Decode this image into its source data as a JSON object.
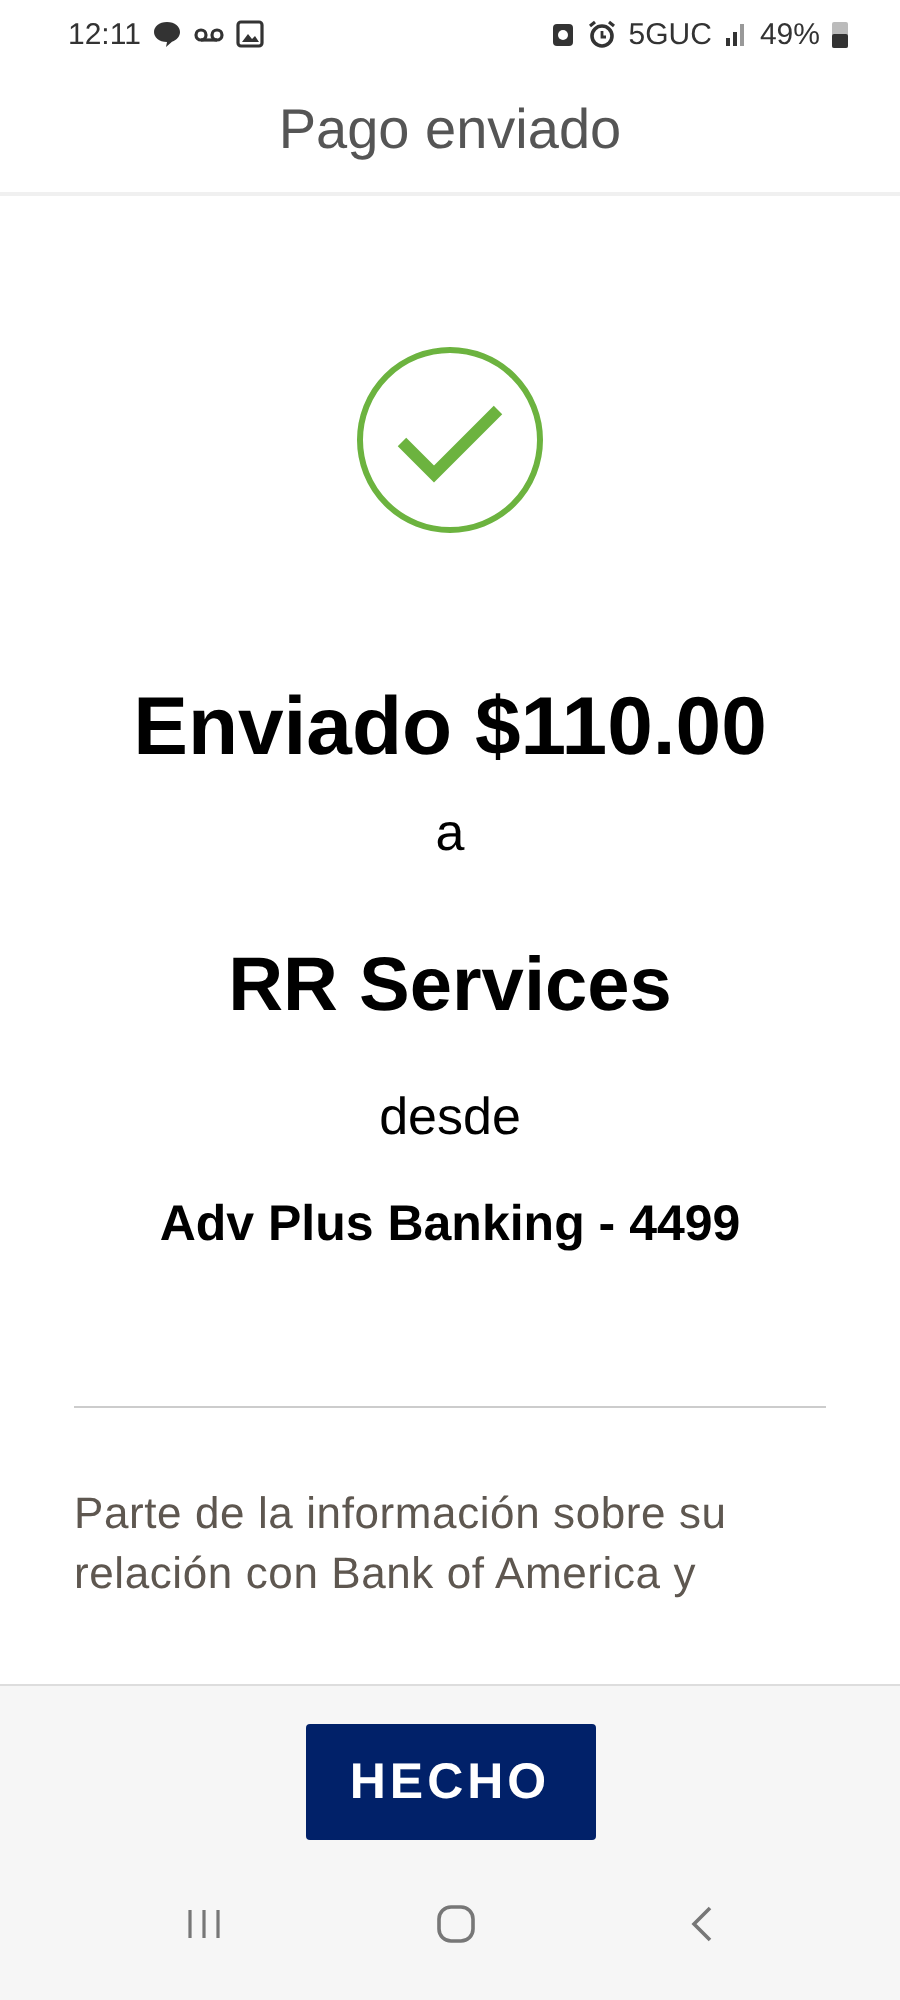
{
  "status_bar": {
    "time": "12:11",
    "network": "5GUC",
    "battery": "49%"
  },
  "header": {
    "title": "Pago enviado"
  },
  "confirmation": {
    "sent_line": "Enviado $110.00",
    "to_word": "a",
    "recipient": "RR Services",
    "from_word": "desde",
    "account": "Adv Plus Banking - 4499"
  },
  "disclosure": {
    "text": "Parte de la información sobre su relación con Bank of America y"
  },
  "footer": {
    "button": "HECHO"
  }
}
